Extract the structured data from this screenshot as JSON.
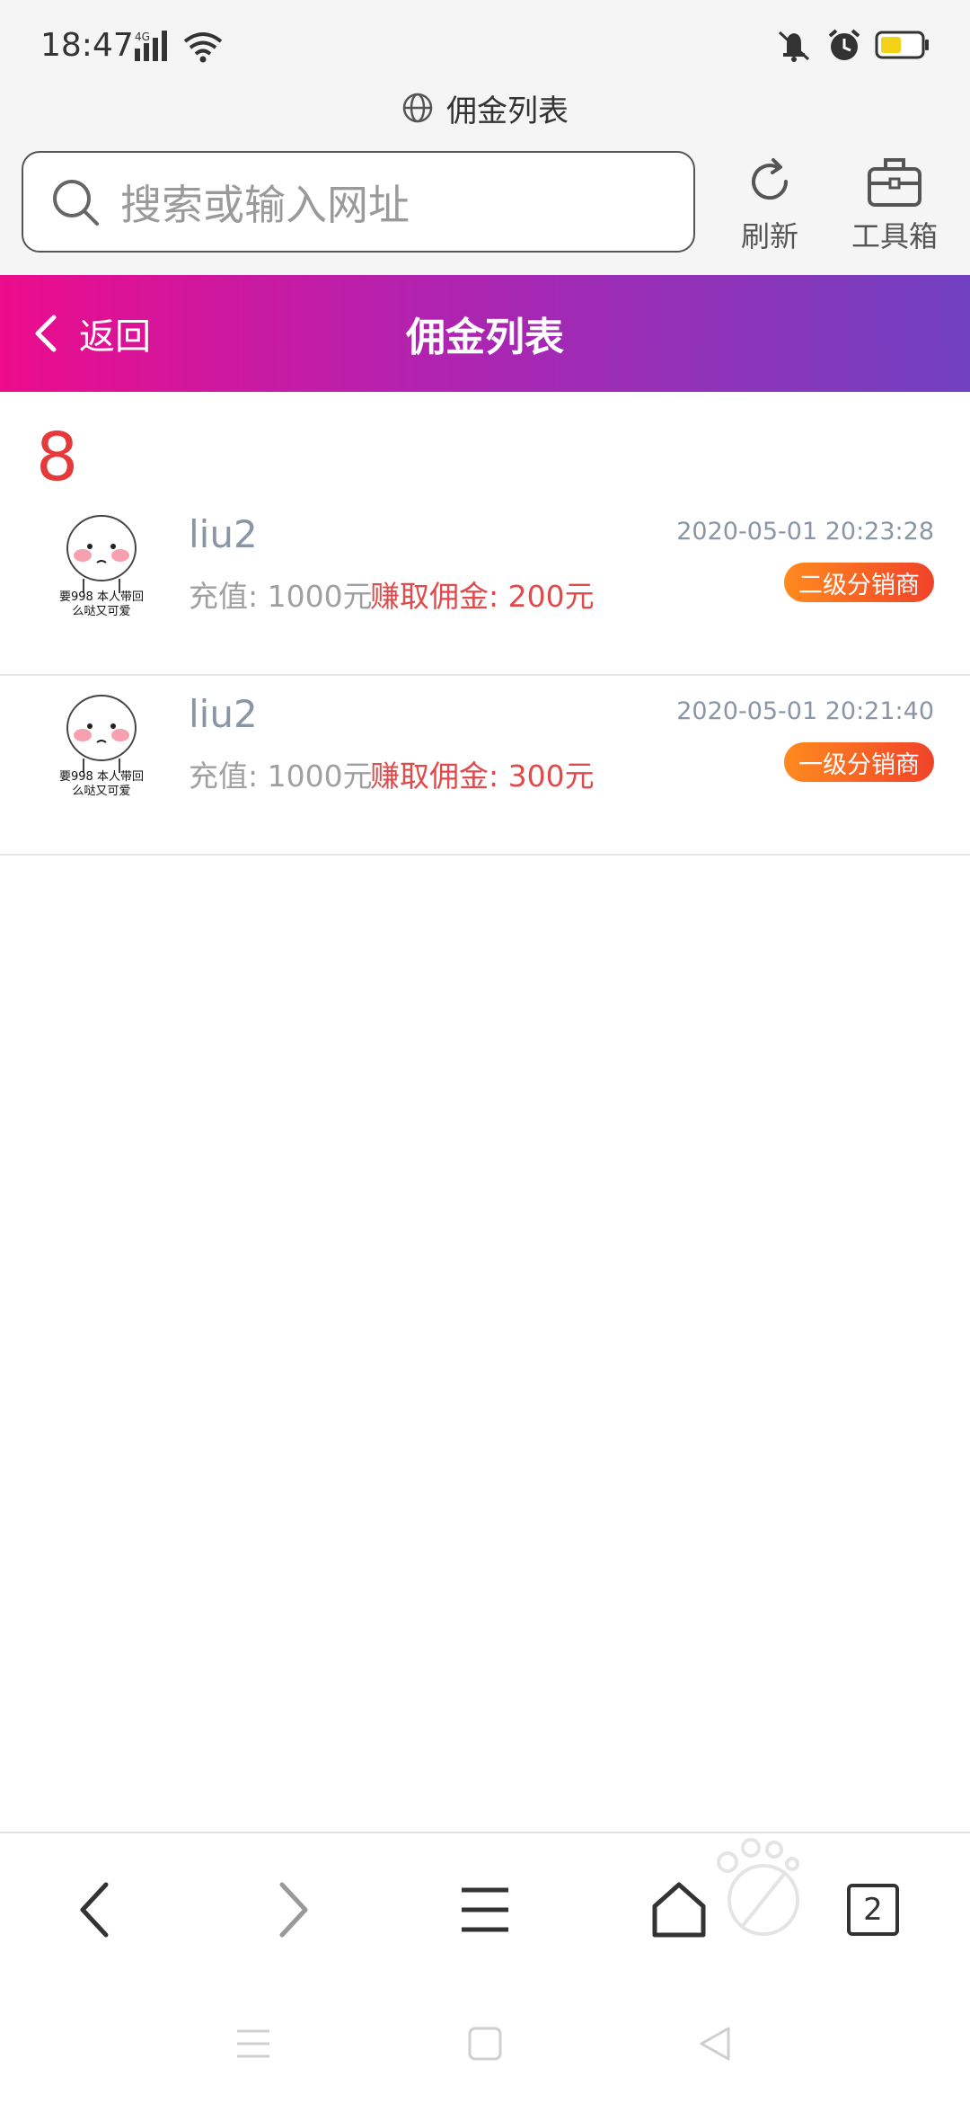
{
  "status_bar": {
    "time": "18:47",
    "network": "4G",
    "icons": [
      "signal-icon",
      "wifi-icon",
      "mute-icon",
      "alarm-icon",
      "battery-icon"
    ]
  },
  "browser": {
    "site_title": "佣金列表",
    "search_placeholder": "搜索或输入网址",
    "refresh_label": "刷新",
    "toolbox_label": "工具箱"
  },
  "header": {
    "back_label": "返回",
    "title": "佣金列表",
    "gradient": [
      "#ec0c8c",
      "#7040c0"
    ]
  },
  "summary": {
    "count": "8"
  },
  "records": [
    {
      "username": "liu2",
      "recharge": "充值: 1000元",
      "earned": "赚取佣金: 200元",
      "datetime": "2020-05-01 20:23:28",
      "level": "二级分销商",
      "avatar_caption_1": "要998 本人带回",
      "avatar_caption_2": "么哒又可爱"
    },
    {
      "username": "liu2",
      "recharge": "充值: 1000元",
      "earned": "赚取佣金: 300元",
      "datetime": "2020-05-01 20:21:40",
      "level": "一级分销商",
      "avatar_caption_1": "要998 本人带回",
      "avatar_caption_2": "么哒又可爱"
    }
  ],
  "bottom_bar": {
    "tab_count": "2"
  },
  "colors": {
    "accent_red": "#e63a3a",
    "badge": "#f0432a",
    "muted_text": "#8a96a6"
  }
}
